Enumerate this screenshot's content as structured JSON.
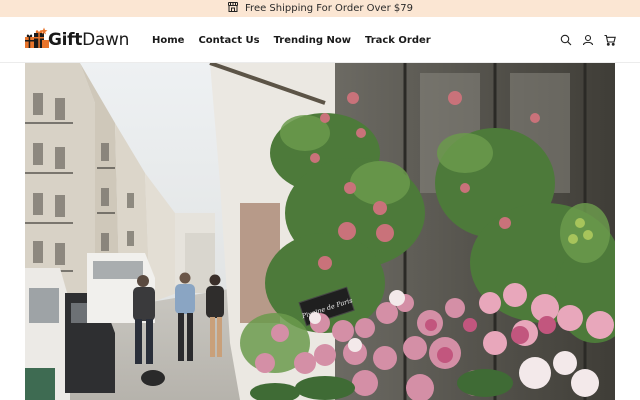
{
  "announcement": {
    "icon": "storefront-icon",
    "text": "Free Shipping For Order Over $79"
  },
  "header": {
    "logo": {
      "brand_bold": "Gift",
      "brand_regular": "Dawn",
      "icon": "gift-boxes-icon",
      "accent": "#e8742b"
    },
    "nav": [
      {
        "label": "Home"
      },
      {
        "label": "Contact Us"
      },
      {
        "label": "Trending Now"
      },
      {
        "label": "Track Order"
      }
    ],
    "icons": [
      "search-icon",
      "account-icon",
      "cart-icon"
    ]
  },
  "hero": {
    "image": "flower-shop-street-photo",
    "sign_text": "Pivoine de Paris"
  },
  "colors": {
    "announcement_bg": "#fbe6d3",
    "text": "#121212",
    "accent": "#e8742b"
  }
}
